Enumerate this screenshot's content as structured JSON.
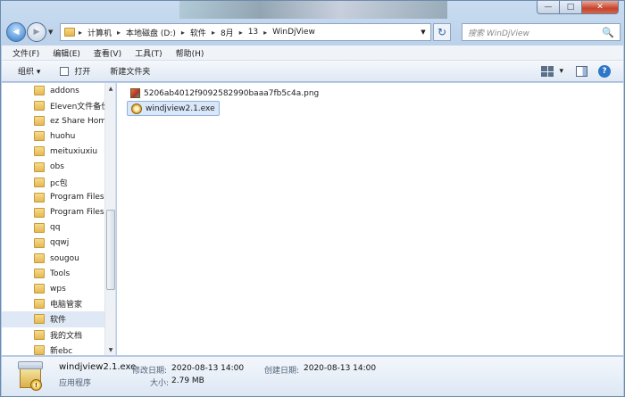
{
  "window": {
    "controls": {
      "minimize": "—",
      "maximize": "□",
      "close": "✕"
    }
  },
  "navigation": {
    "back_icon": "◀",
    "forward_icon": "▶",
    "dropdown_icon": "▼",
    "breadcrumb": [
      {
        "label": "计算机"
      },
      {
        "label": "本地磁盘 (D:)"
      },
      {
        "label": "软件"
      },
      {
        "label": "8月"
      },
      {
        "label": "13"
      },
      {
        "label": "WinDjView"
      }
    ],
    "breadcrumb_separator": "▸",
    "refresh_icon": "↻",
    "search_placeholder": "搜索 WinDjView",
    "search_icon": "🔍"
  },
  "menubar": {
    "items": [
      {
        "label": "文件(F)"
      },
      {
        "label": "编辑(E)"
      },
      {
        "label": "查看(V)"
      },
      {
        "label": "工具(T)"
      },
      {
        "label": "帮助(H)"
      }
    ]
  },
  "toolbar": {
    "organize": "组织 ▾",
    "open": "打开",
    "new_folder": "新建文件夹",
    "view_dropdown": "▾",
    "help": "?"
  },
  "sidebar": {
    "items": [
      {
        "label": "addons",
        "selected": false
      },
      {
        "label": "Eleven文件备份",
        "selected": false
      },
      {
        "label": "ez Share Home",
        "selected": false
      },
      {
        "label": "huohu",
        "selected": false
      },
      {
        "label": "meituxiuxiu",
        "selected": false
      },
      {
        "label": "obs",
        "selected": false
      },
      {
        "label": "pc包",
        "selected": false
      },
      {
        "label": "Program Files",
        "selected": false
      },
      {
        "label": "Program Files",
        "selected": false
      },
      {
        "label": "qq",
        "selected": false
      },
      {
        "label": "qqwj",
        "selected": false
      },
      {
        "label": "sougou",
        "selected": false
      },
      {
        "label": "Tools",
        "selected": false
      },
      {
        "label": "wps",
        "selected": false
      },
      {
        "label": "电脑管家",
        "selected": false
      },
      {
        "label": "软件",
        "selected": true
      },
      {
        "label": "我的文档",
        "selected": false
      },
      {
        "label": "新ebc",
        "selected": false
      }
    ],
    "scroll_up": "▲",
    "scroll_down": "▼"
  },
  "files": [
    {
      "name": "5206ab4012f9092582990baaa7fb5c4a.png",
      "type": "png",
      "selected": false
    },
    {
      "name": "windjview2.1.exe",
      "type": "exe",
      "selected": true
    }
  ],
  "details": {
    "name": "windjview2.1.exe",
    "type": "应用程序",
    "modified_label": "修改日期:",
    "modified_value": "2020-08-13 14:00",
    "created_label": "创建日期:",
    "created_value": "2020-08-13 14:00",
    "size_label": "大小:",
    "size_value": "2.79 MB"
  }
}
